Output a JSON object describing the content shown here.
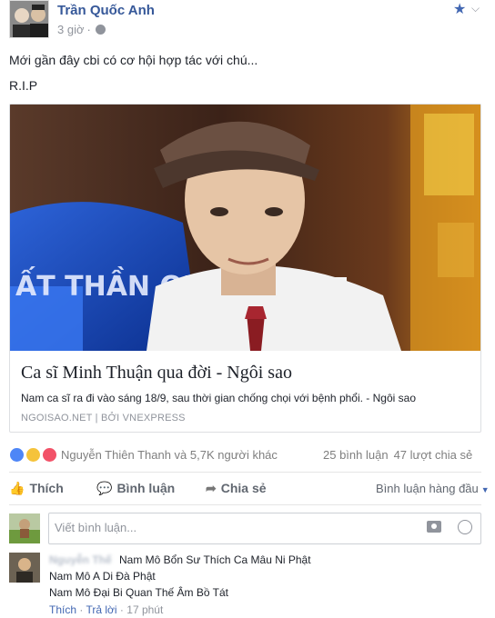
{
  "post": {
    "author": "Trần Quốc Anh",
    "timestamp": "3 giờ",
    "separator": "·",
    "privacy_icon": "globe-icon",
    "message_lines": [
      "Mới gần đây cbi có cơ hội hợp tác với chú...",
      "R.I.P"
    ],
    "link": {
      "title": "Ca sĩ Minh Thuận qua đời - Ngôi sao",
      "description": "Nam ca sĩ ra đi vào sáng 18/9, sau thời gian chống chọi với bệnh phổi. - Ngôi sao",
      "source": "NGOISAO.NET | BỞI VNEXPRESS",
      "image_text": "ẤT THẦN QUE"
    },
    "reactions": {
      "summary": "Nguyễn Thiên Thanh và 5,7K người khác",
      "comments": "25 bình luận",
      "shares": "47 lượt chia sẻ",
      "colors": {
        "like": "#4e86f7",
        "sad": "#f5c33b",
        "love": "#f25268"
      }
    },
    "actions": {
      "like": "Thích",
      "comment": "Bình luận",
      "share": "Chia sẻ",
      "sort": "Bình luận hàng đầu"
    },
    "comment_input": {
      "placeholder": "Viết bình luận..."
    },
    "comment": {
      "name": "Nguyễn Thế",
      "lines": [
        "Nam Mô Bổn Sư Thích Ca Mâu Ni Phật",
        "Nam Mô A Di Đà Phật",
        "Nam Mô Đại Bi Quan Thế Âm Bồ Tát"
      ],
      "like": "Thích",
      "reply": "Trả lời",
      "time": "17 phút",
      "sep": "·"
    }
  }
}
